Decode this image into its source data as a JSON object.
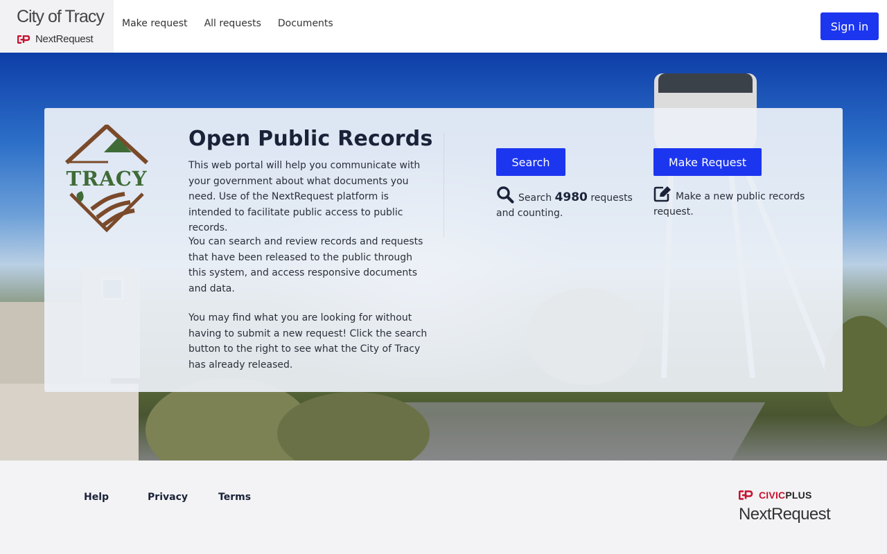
{
  "header": {
    "brand_title": "City of Tracy",
    "brand_sub": "NextRequest",
    "nav": [
      {
        "label": "Make request"
      },
      {
        "label": "All requests"
      },
      {
        "label": "Documents"
      }
    ],
    "signin_label": "Sign in"
  },
  "main": {
    "logo_text": "TRACY",
    "title": "Open Public Records",
    "paragraphs": [
      "This web portal will help you communicate with your government about what documents you need. Use of the NextRequest platform is intended to facilitate public access to public records.",
      "You can search and review records and requests that have been released to the public through this system, and access responsive documents and data.",
      "You may find what you are looking for without having to submit a new request! Click the search button to the right to see what the City of Tracy has already released."
    ],
    "search": {
      "button_label": "Search",
      "desc_prefix": "Search",
      "count": "4980",
      "desc_suffix": "requests and counting."
    },
    "make_request": {
      "button_label": "Make Request",
      "desc": "Make a new public records request."
    }
  },
  "footer": {
    "links": [
      {
        "label": "Help"
      },
      {
        "label": "Privacy"
      },
      {
        "label": "Terms"
      }
    ],
    "civic_brand": "CIVIC",
    "civic_brand_plus": "PLUS",
    "product": "NextRequest"
  },
  "colors": {
    "primary_button": "#1c36f0",
    "title_text": "#1a2238",
    "civicplus_red": "#c8102e"
  },
  "icons": {
    "brand_logo": "nextrequest-logo-icon",
    "search": "search-icon",
    "make_request": "edit-icon",
    "civicplus_logo": "civicplus-logo-icon"
  }
}
